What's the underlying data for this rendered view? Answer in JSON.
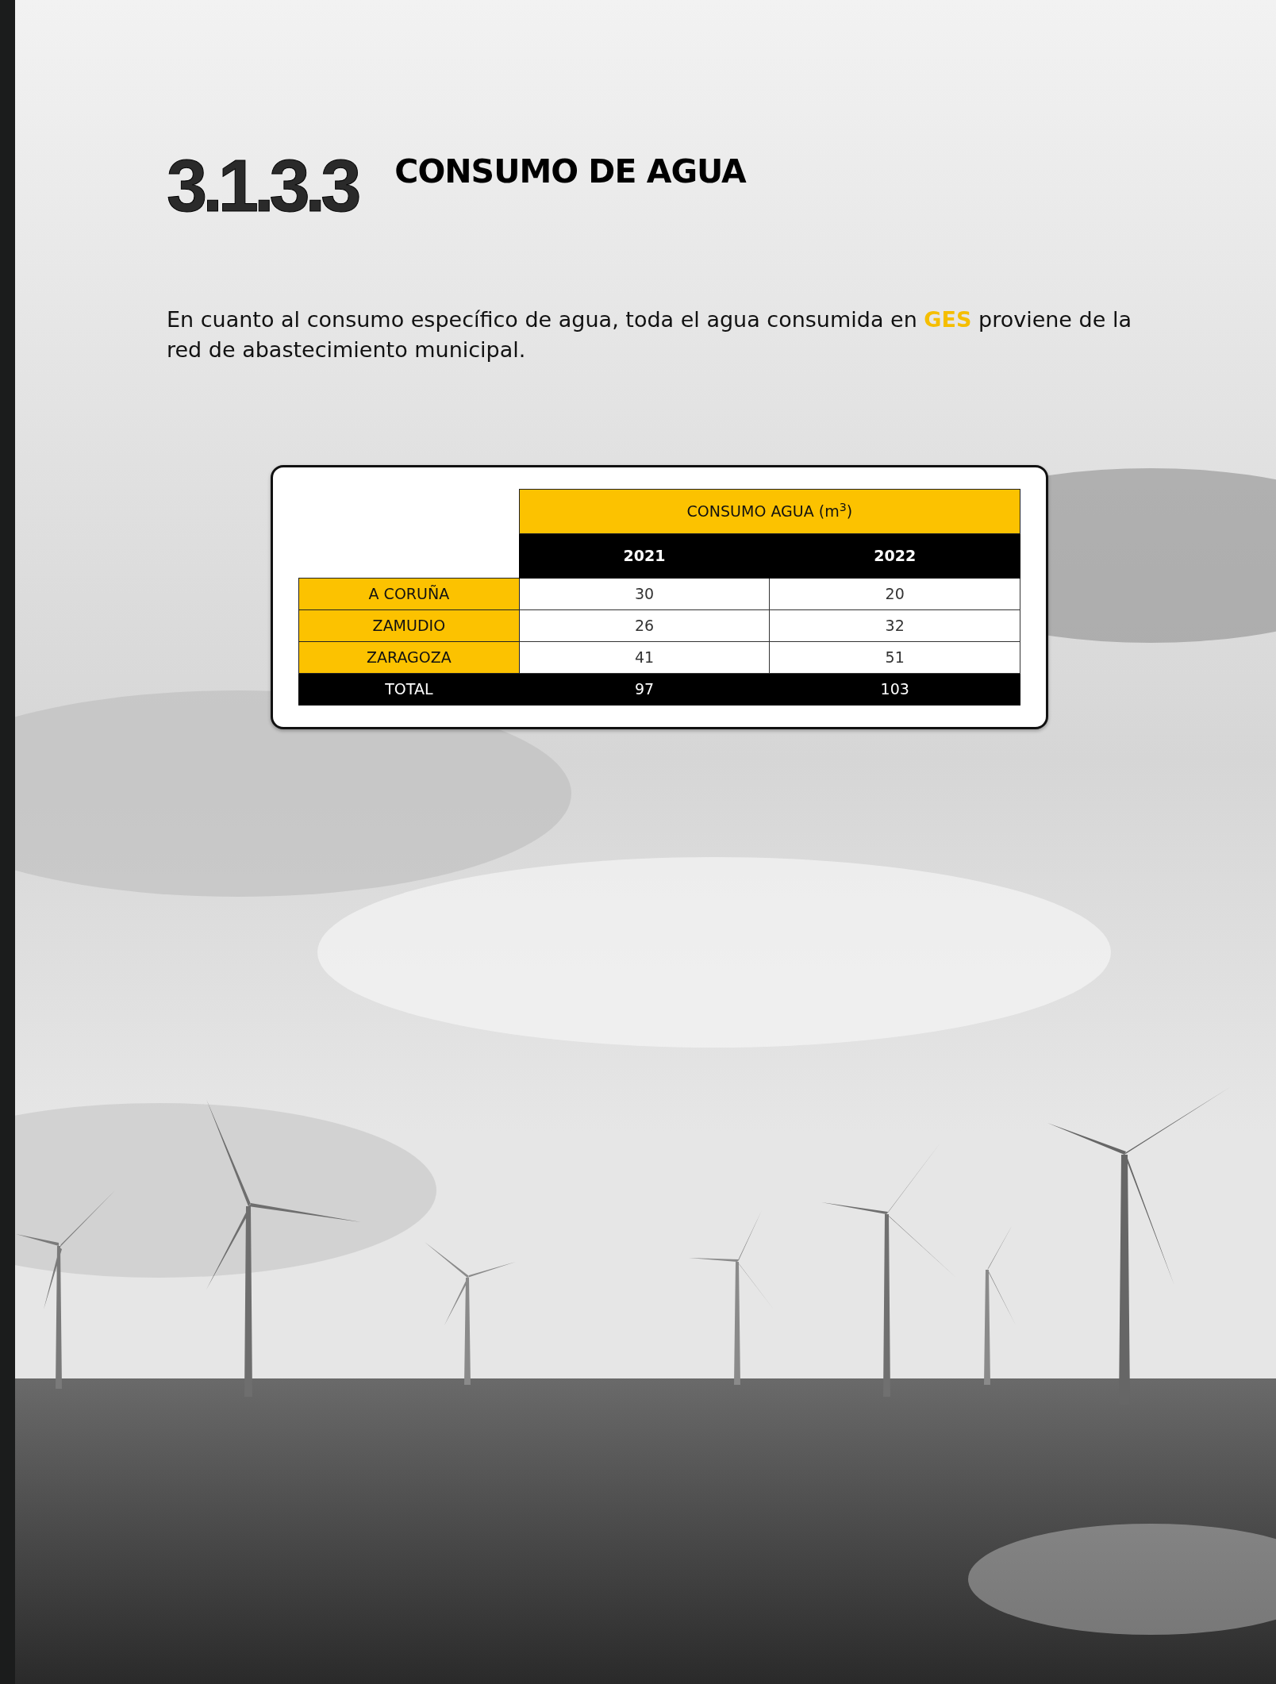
{
  "section": {
    "number": "3.1.3.3",
    "title": "CONSUMO DE AGUA"
  },
  "paragraph": "En cuanto al consumo específico de agua, toda el agua consumida en **GES** proviene de la red de abastecimiento municipal.",
  "table": {
    "group_header": "CONSUMO AGUA (m$^{3}$)",
    "columns": [
      "2021",
      "2022"
    ],
    "rows": [
      {
        "kind": "site",
        "label": "A CORUÑA",
        "values": [
          "30",
          "20"
        ]
      },
      {
        "kind": "site",
        "label": "ZAMUDIO",
        "values": [
          "26",
          "32"
        ]
      },
      {
        "kind": "site",
        "label": "ZARAGOZA",
        "values": [
          "41",
          "51"
        ]
      },
      {
        "kind": "total",
        "label": "TOTAL",
        "values": [
          "97",
          "103"
        ]
      }
    ]
  }
}
